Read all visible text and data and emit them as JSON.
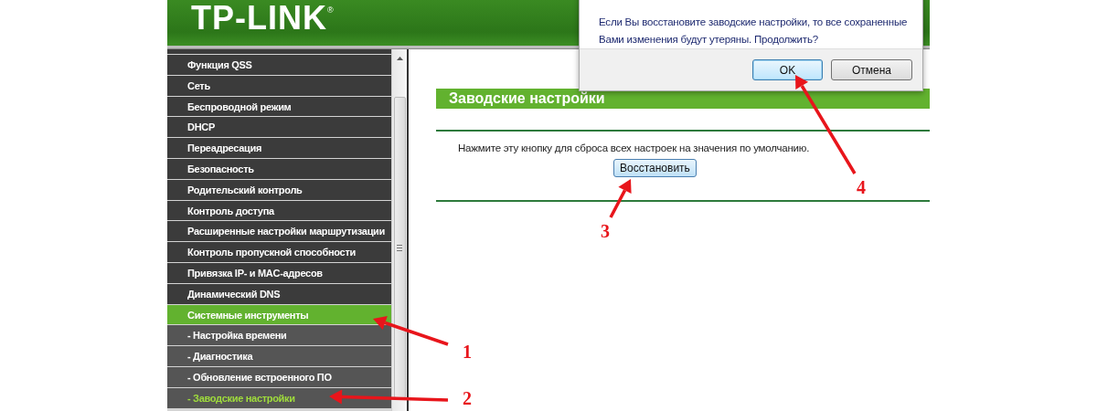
{
  "header": {
    "logo": "TP-LINK",
    "logo_mark": "®"
  },
  "sidebar": {
    "items": [
      {
        "label": "Функция QSS",
        "kind": "main",
        "selected": false
      },
      {
        "label": "Сеть",
        "kind": "main",
        "selected": false
      },
      {
        "label": "Беспроводной режим",
        "kind": "main",
        "selected": false
      },
      {
        "label": "DHCP",
        "kind": "main",
        "selected": false
      },
      {
        "label": "Переадресация",
        "kind": "main",
        "selected": false
      },
      {
        "label": "Безопасность",
        "kind": "main",
        "selected": false
      },
      {
        "label": "Родительский контроль",
        "kind": "main",
        "selected": false
      },
      {
        "label": "Контроль доступа",
        "kind": "main",
        "selected": false
      },
      {
        "label": "Расширенные настройки маршрутизации",
        "kind": "main",
        "selected": false
      },
      {
        "label": "Контроль пропускной способности",
        "kind": "main",
        "selected": false
      },
      {
        "label": "Привязка IP- и MAC-адресов",
        "kind": "main",
        "selected": false
      },
      {
        "label": "Динамический DNS",
        "kind": "main",
        "selected": false
      },
      {
        "label": "Системные инструменты",
        "kind": "main",
        "selected": true
      },
      {
        "label": "- Настройка времени",
        "kind": "sub",
        "selected": false
      },
      {
        "label": "- Диагностика",
        "kind": "sub",
        "selected": false
      },
      {
        "label": "- Обновление встроенного ПО",
        "kind": "sub",
        "selected": false
      },
      {
        "label": "- Заводские настройки",
        "kind": "sub",
        "selected": true
      }
    ]
  },
  "content": {
    "section_title": "Заводские настройки",
    "description": "Нажмите эту кнопку для сброса всех настроек на значения по умолчанию.",
    "restore_button": "Восстановить"
  },
  "dialog": {
    "message": "Если Вы восстановите заводские настройки, то все сохраненные Вами изменения будут утеряны. Продолжить?",
    "buttons": [
      {
        "label": "OK",
        "selected": true
      },
      {
        "label": "Отмена",
        "selected": false
      }
    ]
  },
  "annotations": [
    "1",
    "2",
    "3",
    "4"
  ]
}
